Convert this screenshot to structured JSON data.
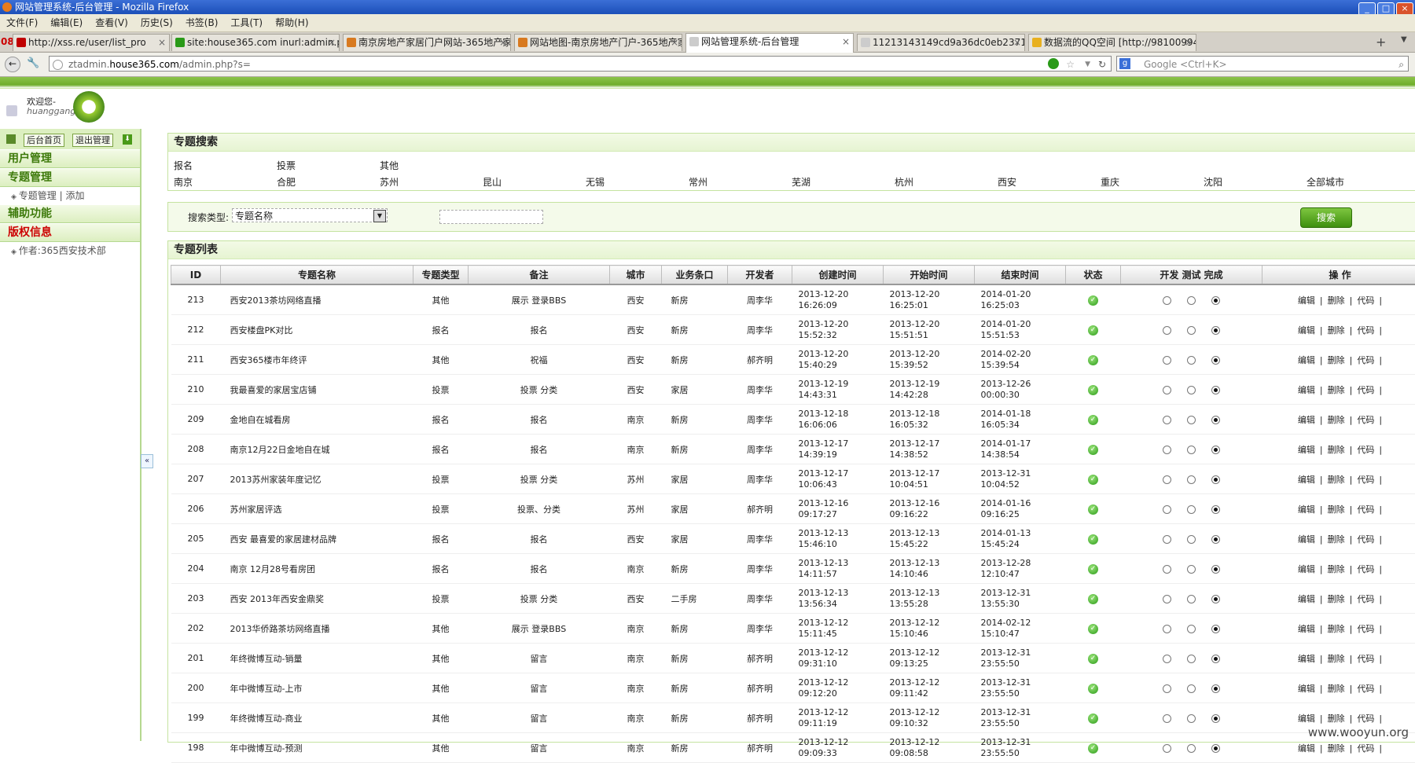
{
  "window": {
    "title": "网站管理系统-后台管理 - Mozilla Firefox"
  },
  "menu": [
    "文件(F)",
    "编辑(E)",
    "查看(V)",
    "历史(S)",
    "书签(B)",
    "工具(T)",
    "帮助(H)"
  ],
  "tabs": [
    {
      "label": "http://xss.re/user/list_pro",
      "icon_color": "#c00000"
    },
    {
      "label": "site:house365.com inurl:admin.php...",
      "icon_color": "#2a9a18"
    },
    {
      "label": "南京房地产家居门户网站-365地产家...",
      "icon_color": "#d87a20"
    },
    {
      "label": "网站地图-南京房地产门户-365地产家...",
      "icon_color": "#d87a20"
    },
    {
      "label": "网站管理系统-后台管理",
      "icon_color": "#cccccc"
    },
    {
      "label": "11213143149cd9a36dc0eb237193...",
      "icon_color": "#cccccc"
    },
    {
      "label": "数据流的QQ空间 [http://98100994...",
      "icon_color": "#e8b020"
    }
  ],
  "tab_badge": "08",
  "nav": {
    "url_prefix": "ztadmin.",
    "url_host": "house365.com",
    "url_path": "/admin.php?s=",
    "search_placeholder": "Google <Ctrl+K>"
  },
  "header": {
    "welcome": "欢迎您-",
    "username": "huanggang"
  },
  "sidebar": {
    "home_btn": "后台首页",
    "logout_btn": "退出管理",
    "sections": [
      {
        "title": "用户管理",
        "items": []
      },
      {
        "title": "专题管理",
        "items": [
          "专题管理 | 添加"
        ]
      },
      {
        "title": "辅助功能",
        "items": []
      },
      {
        "title": "版权信息",
        "items": [
          "作者:365西安技术部"
        ],
        "red": true
      }
    ],
    "collapse_label": "«"
  },
  "search": {
    "title": "专题搜索",
    "types": [
      "报名",
      "投票",
      "其他"
    ],
    "cities": [
      "南京",
      "合肥",
      "苏州",
      "昆山",
      "无锡",
      "常州",
      "芜湖",
      "杭州",
      "西安",
      "重庆",
      "沈阳",
      "全部城市"
    ],
    "filter_label": "搜索类型:",
    "filter_value": "专题名称",
    "button": "搜索"
  },
  "list": {
    "title": "专题列表",
    "columns": [
      "ID",
      "专题名称",
      "专题类型",
      "备注",
      "城市",
      "业务条口",
      "开发者",
      "创建时间",
      "开始时间",
      "结束时间",
      "状态",
      "开发 测试 完成",
      "操 作"
    ],
    "actions": [
      "编辑",
      "删除",
      "代码"
    ],
    "rows": [
      {
        "id": "213",
        "name": "西安2013茶坊网络直播",
        "type": "其他",
        "note": "展示 登录BBS",
        "city": "西安",
        "biz": "新房",
        "dev": "周李华",
        "created": "2013-12-20 16:26:09",
        "start": "2013-12-20 16:25:01",
        "end": "2014-01-20 16:25:03"
      },
      {
        "id": "212",
        "name": "西安楼盘PK对比",
        "type": "报名",
        "note": "报名",
        "city": "西安",
        "biz": "新房",
        "dev": "周李华",
        "created": "2013-12-20 15:52:32",
        "start": "2013-12-20 15:51:51",
        "end": "2014-01-20 15:51:53"
      },
      {
        "id": "211",
        "name": "西安365楼市年终评",
        "type": "其他",
        "note": "祝福",
        "city": "西安",
        "biz": "新房",
        "dev": "郝齐明",
        "created": "2013-12-20 15:40:29",
        "start": "2013-12-20 15:39:52",
        "end": "2014-02-20 15:39:54"
      },
      {
        "id": "210",
        "name": "我最喜爱的家居宝店铺",
        "type": "投票",
        "note": "投票 分类",
        "city": "西安",
        "biz": "家居",
        "dev": "周李华",
        "created": "2013-12-19 14:43:31",
        "start": "2013-12-19 14:42:28",
        "end": "2013-12-26 00:00:30"
      },
      {
        "id": "209",
        "name": "金地自在城看房",
        "type": "报名",
        "note": "报名",
        "city": "南京",
        "biz": "新房",
        "dev": "周李华",
        "created": "2013-12-18 16:06:06",
        "start": "2013-12-18 16:05:32",
        "end": "2014-01-18 16:05:34"
      },
      {
        "id": "208",
        "name": "南京12月22日金地自在城",
        "type": "报名",
        "note": "报名",
        "city": "南京",
        "biz": "新房",
        "dev": "周李华",
        "created": "2013-12-17 14:39:19",
        "start": "2013-12-17 14:38:52",
        "end": "2014-01-17 14:38:54"
      },
      {
        "id": "207",
        "name": "2013苏州家装年度记忆",
        "type": "投票",
        "note": "投票 分类",
        "city": "苏州",
        "biz": "家居",
        "dev": "周李华",
        "created": "2013-12-17 10:06:43",
        "start": "2013-12-17 10:04:51",
        "end": "2013-12-31 10:04:52"
      },
      {
        "id": "206",
        "name": "苏州家居评选",
        "type": "投票",
        "note": "投票、分类",
        "city": "苏州",
        "biz": "家居",
        "dev": "郝齐明",
        "created": "2013-12-16 09:17:27",
        "start": "2013-12-16 09:16:22",
        "end": "2014-01-16 09:16:25"
      },
      {
        "id": "205",
        "name": "西安 最喜爱的家居建材品牌",
        "type": "报名",
        "note": "报名",
        "city": "西安",
        "biz": "家居",
        "dev": "周李华",
        "created": "2013-12-13 15:46:10",
        "start": "2013-12-13 15:45:22",
        "end": "2014-01-13 15:45:24"
      },
      {
        "id": "204",
        "name": "南京 12月28号看房团",
        "type": "报名",
        "note": "报名",
        "city": "南京",
        "biz": "新房",
        "dev": "周李华",
        "created": "2013-12-13 14:11:57",
        "start": "2013-12-13 14:10:46",
        "end": "2013-12-28 12:10:47"
      },
      {
        "id": "203",
        "name": "西安 2013年西安金鼎奖",
        "type": "投票",
        "note": "投票 分类",
        "city": "西安",
        "biz": "二手房",
        "dev": "周李华",
        "created": "2013-12-13 13:56:34",
        "start": "2013-12-13 13:55:28",
        "end": "2013-12-31 13:55:30"
      },
      {
        "id": "202",
        "name": "2013华侨路茶坊网络直播",
        "type": "其他",
        "note": "展示 登录BBS",
        "city": "南京",
        "biz": "新房",
        "dev": "周李华",
        "created": "2013-12-12 15:11:45",
        "start": "2013-12-12 15:10:46",
        "end": "2014-02-12 15:10:47"
      },
      {
        "id": "201",
        "name": "年终微博互动-销量",
        "type": "其他",
        "note": "留言",
        "city": "南京",
        "biz": "新房",
        "dev": "郝齐明",
        "created": "2013-12-12 09:31:10",
        "start": "2013-12-12 09:13:25",
        "end": "2013-12-31 23:55:50"
      },
      {
        "id": "200",
        "name": "年中微博互动-上市",
        "type": "其他",
        "note": "留言",
        "city": "南京",
        "biz": "新房",
        "dev": "郝齐明",
        "created": "2013-12-12 09:12:20",
        "start": "2013-12-12 09:11:42",
        "end": "2013-12-31 23:55:50"
      },
      {
        "id": "199",
        "name": "年终微博互动-商业",
        "type": "其他",
        "note": "留言",
        "city": "南京",
        "biz": "新房",
        "dev": "郝齐明",
        "created": "2013-12-12 09:11:19",
        "start": "2013-12-12 09:10:32",
        "end": "2013-12-31 23:55:50"
      },
      {
        "id": "198",
        "name": "年中微博互动-预测",
        "type": "其他",
        "note": "留言",
        "city": "南京",
        "biz": "新房",
        "dev": "郝齐明",
        "created": "2013-12-12 09:09:33",
        "start": "2013-12-12 09:08:58",
        "end": "2013-12-31 23:55:50"
      }
    ]
  },
  "watermark": "www.wooyun.org",
  "colors": {
    "accent_green": "#6fae2a",
    "status_ok": "#2a9a18",
    "copyright_red": "#cc0000"
  }
}
